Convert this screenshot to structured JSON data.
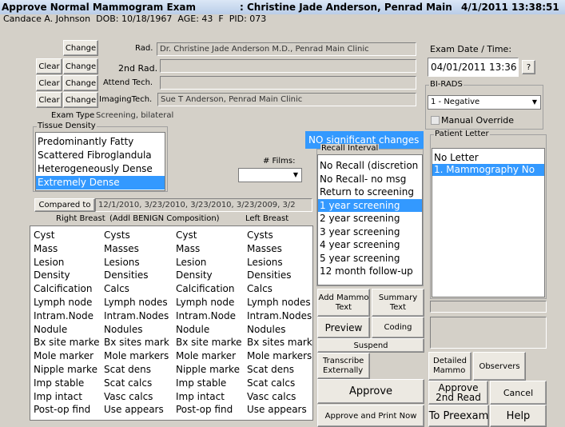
{
  "title": {
    "left": "Approve Normal Mammogram Exam",
    "center": ": Christine Jade Anderson, Penrad Main",
    "right": "4/1/2011 13:38:51"
  },
  "patient": {
    "name": "Candace A. Johnson",
    "dob": "DOB: 10/18/1967",
    "age": "AGE: 43",
    "sex": "F",
    "pid": "PID: 073"
  },
  "labels": {
    "rad": "Rad.",
    "rad2": "2nd Rad.",
    "attend_tech": "Attend Tech.",
    "imaging_tech": "ImagingTech.",
    "exam_type": "Exam Type",
    "exam_datetime": "Exam Date / Time:",
    "films": "# Films:",
    "right_breast": "Right Breast",
    "benign_comp": "(Addl BENIGN Composition)",
    "left_breast": "Left Breast"
  },
  "fields": {
    "rad": "Dr. Christine Jade Anderson M.D., Penrad Main Clinic",
    "rad2": "",
    "attend_tech": "",
    "imaging_tech": "Sue T Anderson, Penrad Main Clinic",
    "exam_type": "Screening, bilateral",
    "compared_to": "12/1/2010, 3/23/2010, 3/23/2010, 3/23/2009, 3/2",
    "exam_datetime": "04/01/2011 13:36",
    "findings": "NO significant changes"
  },
  "buttons": {
    "change": "Change",
    "clear": "Clear",
    "help_q": "?",
    "compared_to": "Compared to",
    "add_mammo_1": "Add Mammo",
    "add_mammo_2": "Text",
    "summary_1": "Summary",
    "summary_2": "Text",
    "preview": "Preview",
    "coding": "Coding",
    "suspend": "Suspend",
    "transcribe_1": "Transcribe",
    "transcribe_2": "Externally",
    "detailed_1": "Detailed",
    "detailed_2": "Mammo",
    "observers": "Observers",
    "approve": "Approve",
    "approve_2nd_1": "Approve",
    "approve_2nd_2": "2nd Read",
    "cancel": "Cancel",
    "approve_print": "Approve and Print Now",
    "to_preexam": "To Preexam",
    "help": "Help"
  },
  "tissue_density": {
    "caption": "Tissue Density",
    "items": [
      "Predominantly Fatty",
      "Scattered Fibroglandula",
      "Heterogeneously Dense",
      "Extremely Dense"
    ],
    "selected": 3
  },
  "films": {
    "value": ""
  },
  "birads": {
    "caption": "BI-RADS",
    "value": "1 - Negative",
    "manual_override": "Manual Override"
  },
  "recall": {
    "caption": "Recall Interval",
    "items": [
      "No Recall (discretion",
      "No Recall- no msg",
      "Return to screening",
      "1  year screening",
      "2  year screening",
      "3  year screening",
      "4  year screening",
      "5  year screening",
      "12 month follow-up"
    ],
    "selected": 3
  },
  "patient_letter": {
    "caption": "Patient Letter",
    "items": [
      "No Letter",
      "1. Mammography No"
    ],
    "selected": 1
  },
  "composition": {
    "right_a": [
      "Cyst",
      "Mass",
      "Lesion",
      "Density",
      "Calcification",
      "Lymph node",
      "Intram.Node",
      "Nodule",
      "Bx site marke",
      "Mole marker",
      "Nipple marke",
      "Imp stable",
      "Imp intact",
      "Post-op find"
    ],
    "right_b": [
      "Cysts",
      "Masses",
      "Lesions",
      "Densities",
      "Calcs",
      "Lymph nodes",
      "Intram.Nodes",
      "Nodules",
      "Bx sites mark",
      "Mole markers",
      "Scat dens",
      "Scat calcs",
      "Vasc calcs",
      "Use appears"
    ],
    "left_a": [
      "Cyst",
      "Mass",
      "Lesion",
      "Density",
      "Calcification",
      "Lymph node",
      "Intram.Node",
      "Nodule",
      "Bx site marke",
      "Mole marker",
      "Nipple marke",
      "Imp stable",
      "Imp intact",
      "Post-op find"
    ],
    "left_b": [
      "Cysts",
      "Masses",
      "Lesions",
      "Densities",
      "Calcs",
      "Lymph nodes",
      "Intram.Nodes",
      "Nodules",
      "Bx sites mark",
      "Mole markers",
      "Scat dens",
      "Scat calcs",
      "Vasc calcs",
      "Use appears"
    ]
  },
  "colors": {
    "selection": "#3399ff",
    "findings_border": "#3399ff",
    "title_bg": "#c6d7ee"
  }
}
